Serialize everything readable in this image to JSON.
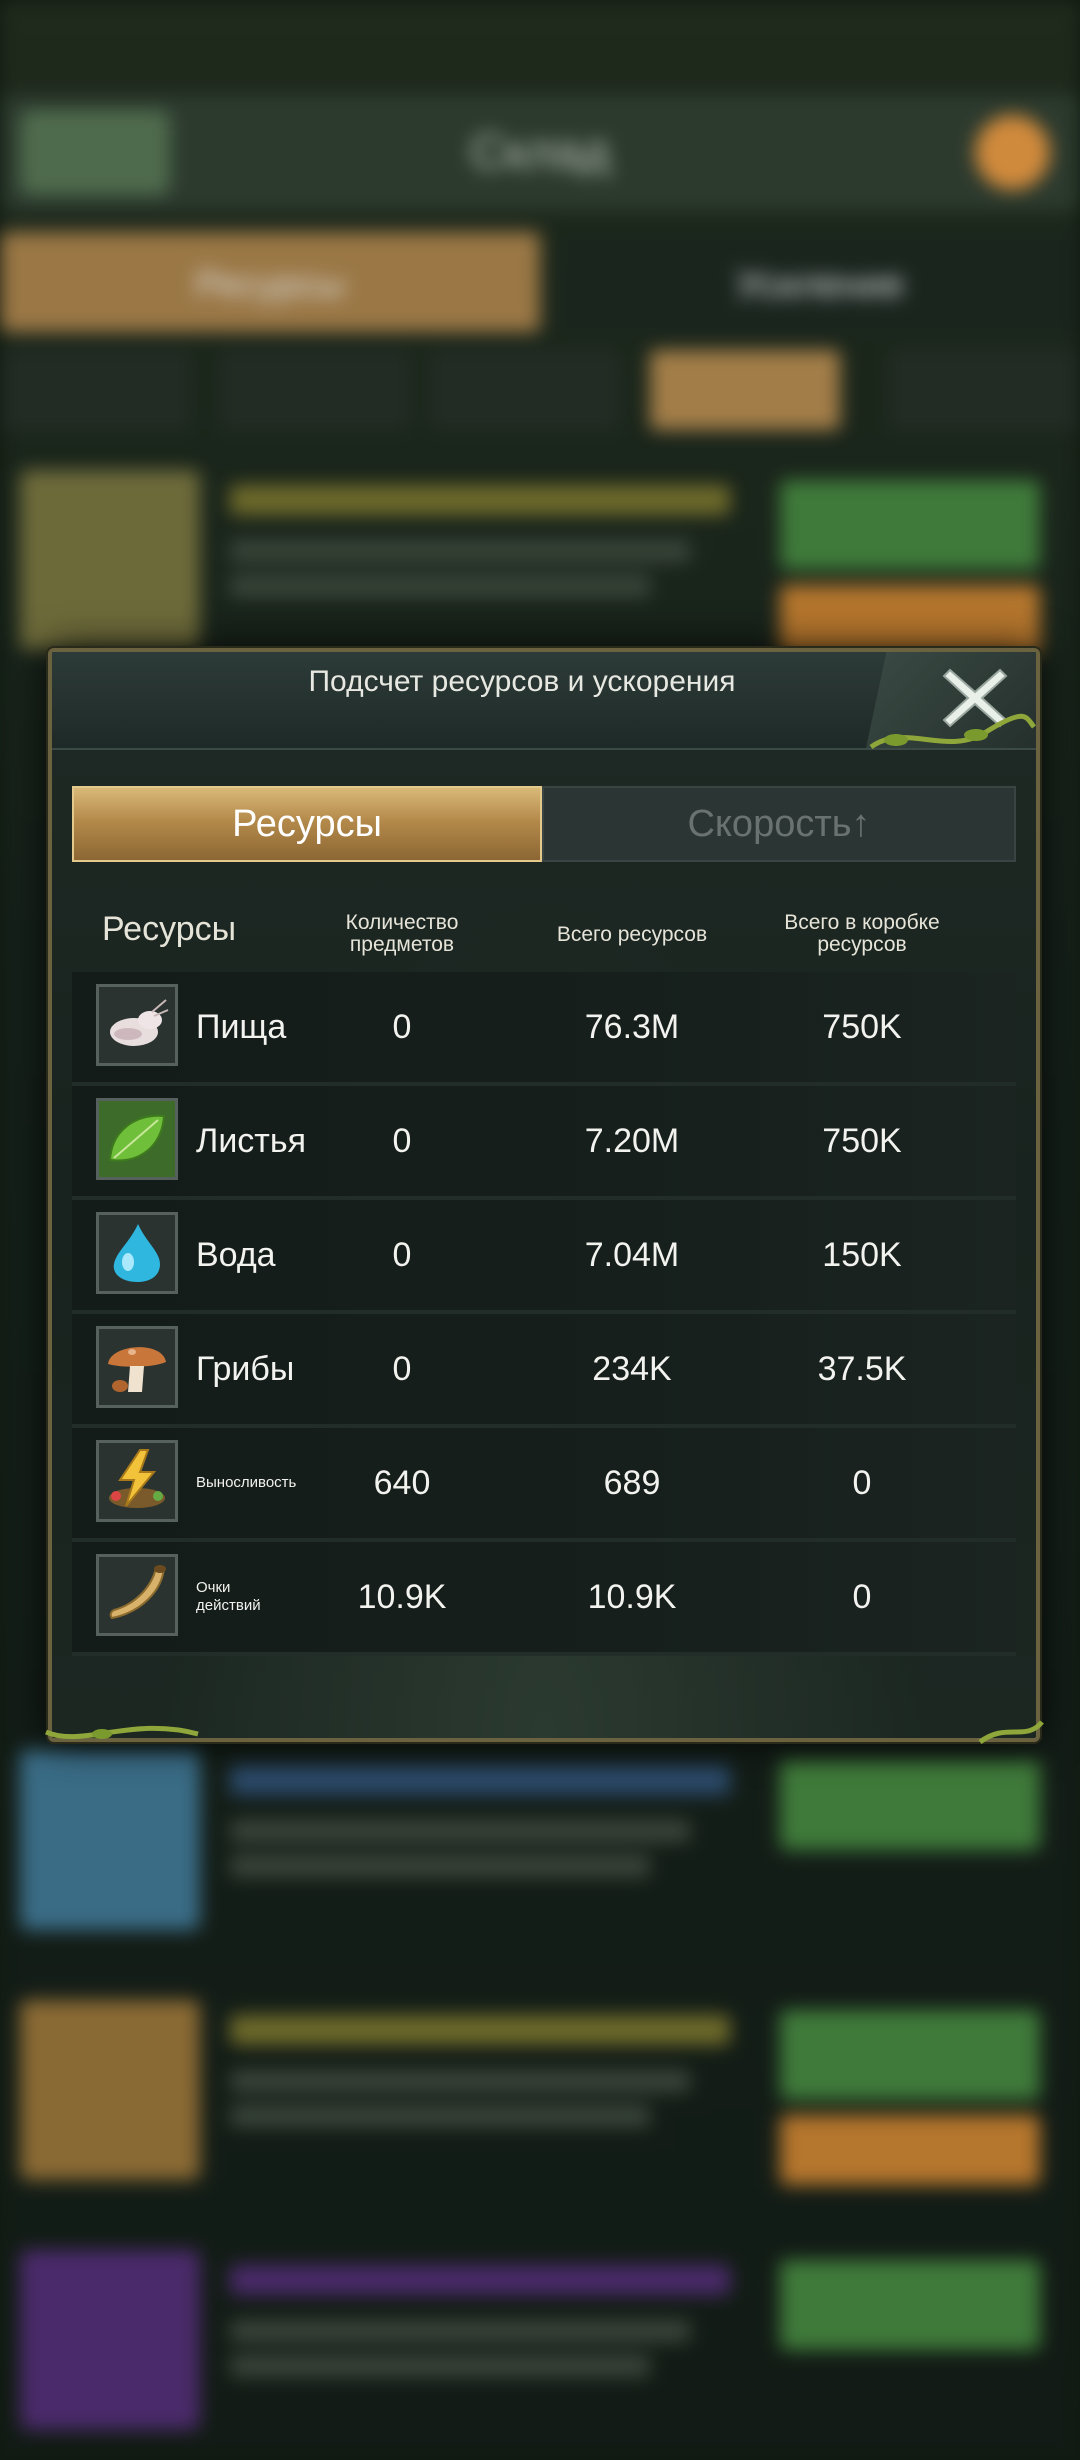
{
  "background": {
    "title": "Склад",
    "tabs": [
      "Ресурсы",
      "Усиление"
    ]
  },
  "modal": {
    "title": "Подсчет ресурсов и ускорения",
    "tabs": {
      "active": "Ресурсы",
      "inactive": "Скорость↑"
    },
    "columns": {
      "resource": "Ресурсы",
      "items": "Количество предметов",
      "total": "Всего ресурсов",
      "box_total": "Всего в коробке ресурсов"
    },
    "rows": [
      {
        "icon": "food-icon",
        "name": "Пища",
        "items": "0",
        "total": "76.3M",
        "box": "750K"
      },
      {
        "icon": "leaves-icon",
        "name": "Листья",
        "items": "0",
        "total": "7.20M",
        "box": "750K"
      },
      {
        "icon": "water-icon",
        "name": "Вода",
        "items": "0",
        "total": "7.04M",
        "box": "150K"
      },
      {
        "icon": "mushroom-icon",
        "name": "Грибы",
        "items": "0",
        "total": "234K",
        "box": "37.5K"
      },
      {
        "icon": "stamina-icon",
        "name": "Выносливость",
        "items": "640",
        "total": "689",
        "box": "0"
      },
      {
        "icon": "horn-icon",
        "name": "Очки действий",
        "items": "10.9K",
        "total": "10.9K",
        "box": "0"
      }
    ]
  }
}
